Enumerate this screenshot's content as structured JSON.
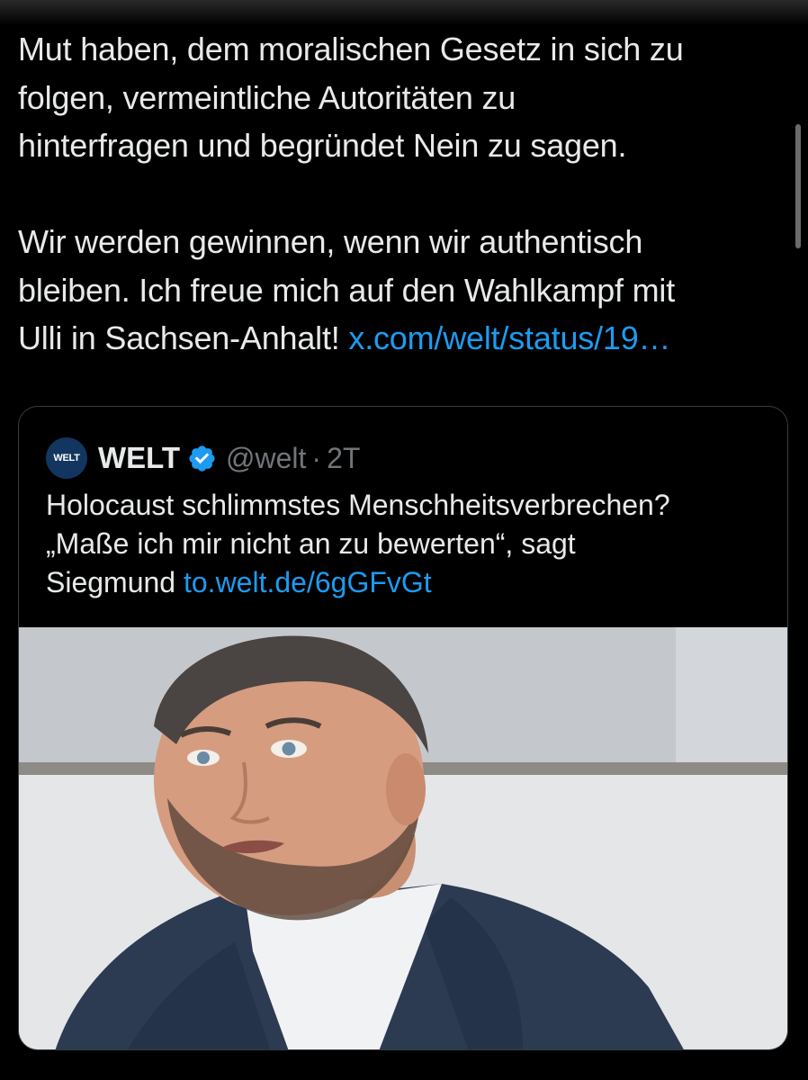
{
  "tweet": {
    "lines": [
      "Mut haben, dem moralischen Gesetz in sich zu",
      "folgen, vermeintliche Autoritäten zu",
      "hinterfragen und begründet Nein zu sagen.",
      "Wir werden gewinnen, wenn wir authentisch",
      "bleiben. Ich freue mich auf den Wahlkampf mit",
      "Ulli in Sachsen-Anhalt! "
    ],
    "link_text": "x.com/welt/status/19…"
  },
  "quote": {
    "avatar_text": "WELT",
    "display_name": "WELT",
    "handle": "@welt",
    "separator": "·",
    "age": "2T",
    "text_lines": [
      "Holocaust schlimmstes Menschheitsverbrechen?",
      "„Maße ich mir nicht an zu bewerten“, sagt",
      "Siegmund "
    ],
    "link_text": "to.welt.de/6gGFvGt",
    "verified_icon": "verified-badge-icon"
  },
  "colors": {
    "background": "#000000",
    "text": "#e7e9ea",
    "link": "#1d9bf0",
    "secondary": "#71767b",
    "border": "#3a3d41"
  }
}
